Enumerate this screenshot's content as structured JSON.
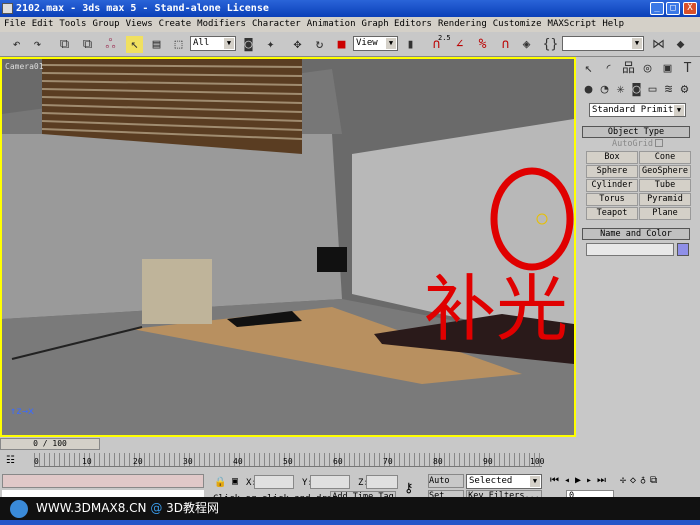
{
  "window": {
    "title": "2102.max - 3ds max 5 - Stand-alone License",
    "controls": [
      "_",
      "□",
      "X"
    ]
  },
  "menu": [
    "File",
    "Edit",
    "Tools",
    "Group",
    "Views",
    "Create",
    "Modifiers",
    "Character",
    "Animation",
    "Graph Editors",
    "Rendering",
    "Customize",
    "MAXScript",
    "Help"
  ],
  "toolbar": {
    "selection_filter": "All",
    "ref_coord": "View",
    "snap_label": "2.5",
    "named_selection": ""
  },
  "viewport": {
    "label": "Camera01",
    "annotation_text": "补光",
    "annotation_color": "#e00000",
    "border_color": "#ffff00"
  },
  "panel": {
    "category": "Standard Primitiv",
    "object_type_title": "Object Type",
    "autogrid": "AutoGrid",
    "buttons": [
      "Box",
      "Cone",
      "Sphere",
      "GeoSphere",
      "Cylinder",
      "Tube",
      "Torus",
      "Pyramid",
      "Teapot",
      "Plane"
    ],
    "name_color_title": "Name and Color",
    "object_name": "",
    "object_color": "#8f8fe8"
  },
  "timeline": {
    "frame_display": "0 / 100",
    "ticks": [
      "0",
      "10",
      "20",
      "30",
      "40",
      "50",
      "60",
      "70",
      "80",
      "90",
      "100"
    ]
  },
  "status": {
    "x_label": "X:",
    "y_label": "Y:",
    "z_label": "Z:",
    "prompt": "Click or click-and-drag",
    "add_time_tag": "Add Time Tag",
    "auto_key": "Auto Key",
    "set_key": "Set Key",
    "key_mode": "Selected",
    "key_filters": "Key Filters...",
    "current_frame": "0"
  },
  "banner": {
    "text": "WWW.3DMAX8.CN",
    "at": "@",
    "site": "3D教程网"
  }
}
